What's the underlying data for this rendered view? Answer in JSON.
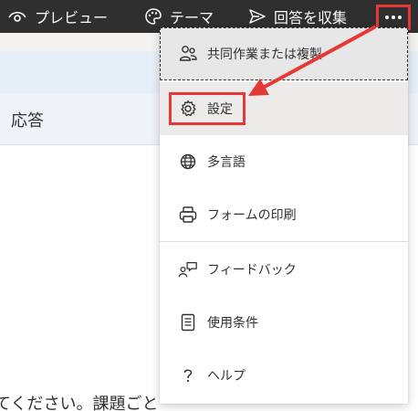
{
  "toolbar": {
    "preview_label": "プレビュー",
    "theme_label": "テーマ",
    "collect_label": "回答を収集",
    "icons": {
      "preview": "eye-icon",
      "theme": "palette-icon",
      "collect": "send-icon",
      "more": "more-icon"
    }
  },
  "background": {
    "tab_label": "応答",
    "bottom_text": "てください。課題ごと"
  },
  "menu": {
    "items": [
      {
        "label": "共同作業または複製",
        "icon": "people-icon"
      },
      {
        "label": "設定",
        "icon": "gear-icon"
      },
      {
        "label": "多言語",
        "icon": "globe-icon"
      },
      {
        "label": "フォームの印刷",
        "icon": "printer-icon"
      },
      {
        "label": "フィードバック",
        "icon": "feedback-icon"
      },
      {
        "label": "使用条件",
        "icon": "document-icon"
      },
      {
        "label": "ヘルプ",
        "icon": "question-icon"
      }
    ]
  },
  "annotation": {
    "color": "#e53935"
  },
  "colors": {
    "toolbar_bg": "#2f2f2f",
    "menu_bg": "#ffffff",
    "highlight": "#e53935"
  }
}
